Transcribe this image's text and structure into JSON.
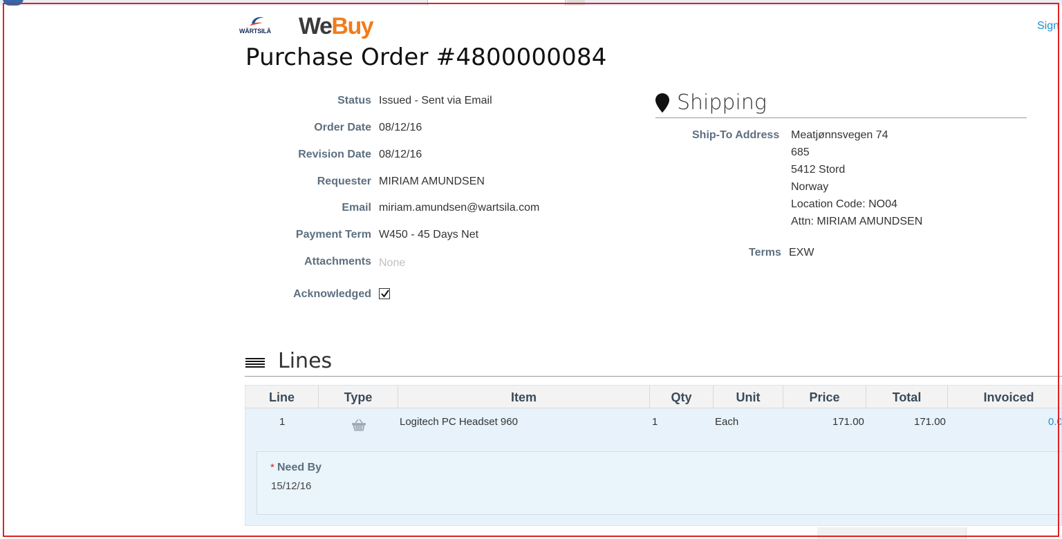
{
  "brand": {
    "partner_logo_text": "WÄRTSILÄ",
    "app_name_part1": "We",
    "app_name_part2": "Buy"
  },
  "header": {
    "sign_link": "Sign"
  },
  "page_title": "Purchase Order #4800000084",
  "details": [
    {
      "label": "Status",
      "value": "Issued - Sent via Email"
    },
    {
      "label": "Order Date",
      "value": "08/12/16"
    },
    {
      "label": "Revision Date",
      "value": "08/12/16"
    },
    {
      "label": "Requester",
      "value": "MIRIAM AMUNDSEN"
    },
    {
      "label": "Email",
      "value": "miriam.amundsen@wartsila.com"
    },
    {
      "label": "Payment Term",
      "value": "W450 - 45 Days Net"
    },
    {
      "label": "Attachments",
      "value": "None"
    }
  ],
  "acknowledged": {
    "label": "Acknowledged",
    "checked": true
  },
  "shipping": {
    "title": "Shipping",
    "ship_to_label": "Ship-To Address",
    "address_lines": [
      "Meatjønnsvegen 74",
      "685",
      "5412 Stord",
      "Norway",
      "Location Code: NO04",
      "Attn: MIRIAM AMUNDSEN"
    ],
    "terms_label": "Terms",
    "terms_value": "EXW"
  },
  "lines": {
    "title": "Lines",
    "columns": [
      "Line",
      "Type",
      "Item",
      "Qty",
      "Unit",
      "Price",
      "Total",
      "Invoiced"
    ],
    "rows": [
      {
        "line": "1",
        "type_icon": "basket-icon",
        "item": "Logitech PC Headset 960",
        "qty": "1",
        "unit": "Each",
        "price": "171.00",
        "total": "171.00",
        "invoiced": "0.0"
      }
    ],
    "need_by": {
      "label": "Need By",
      "value": "15/12/16",
      "required_marker": "*"
    }
  }
}
